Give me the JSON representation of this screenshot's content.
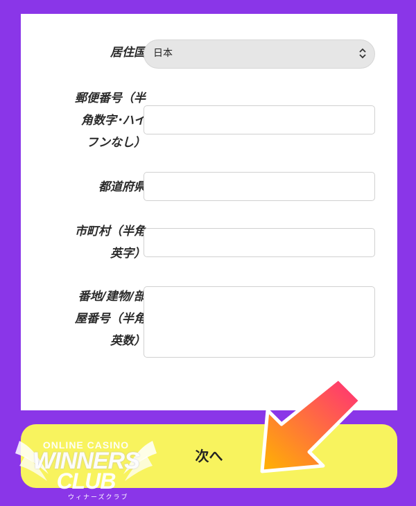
{
  "form": {
    "country": {
      "label": "居住国",
      "value": "日本"
    },
    "postal": {
      "label": "郵便番号（半\n角数字･ハイ\nフンなし）",
      "value": ""
    },
    "prefecture": {
      "label": "都道府県",
      "value": ""
    },
    "city": {
      "label": "市町村（半角\n英字）",
      "value": ""
    },
    "address": {
      "label": "番地/建物/部\n屋番号（半角\n英数）",
      "value": ""
    }
  },
  "next_button": {
    "label": "次へ"
  },
  "logo": {
    "line1": "ONLINE CASINO",
    "line2": "WINNERS",
    "line3": "CLUB",
    "kana": "ウィナーズクラブ"
  },
  "colors": {
    "background": "#8a36e8",
    "button": "#f8f35e",
    "arrow_start": "#ff2d7a",
    "arrow_end": "#ffb400"
  }
}
